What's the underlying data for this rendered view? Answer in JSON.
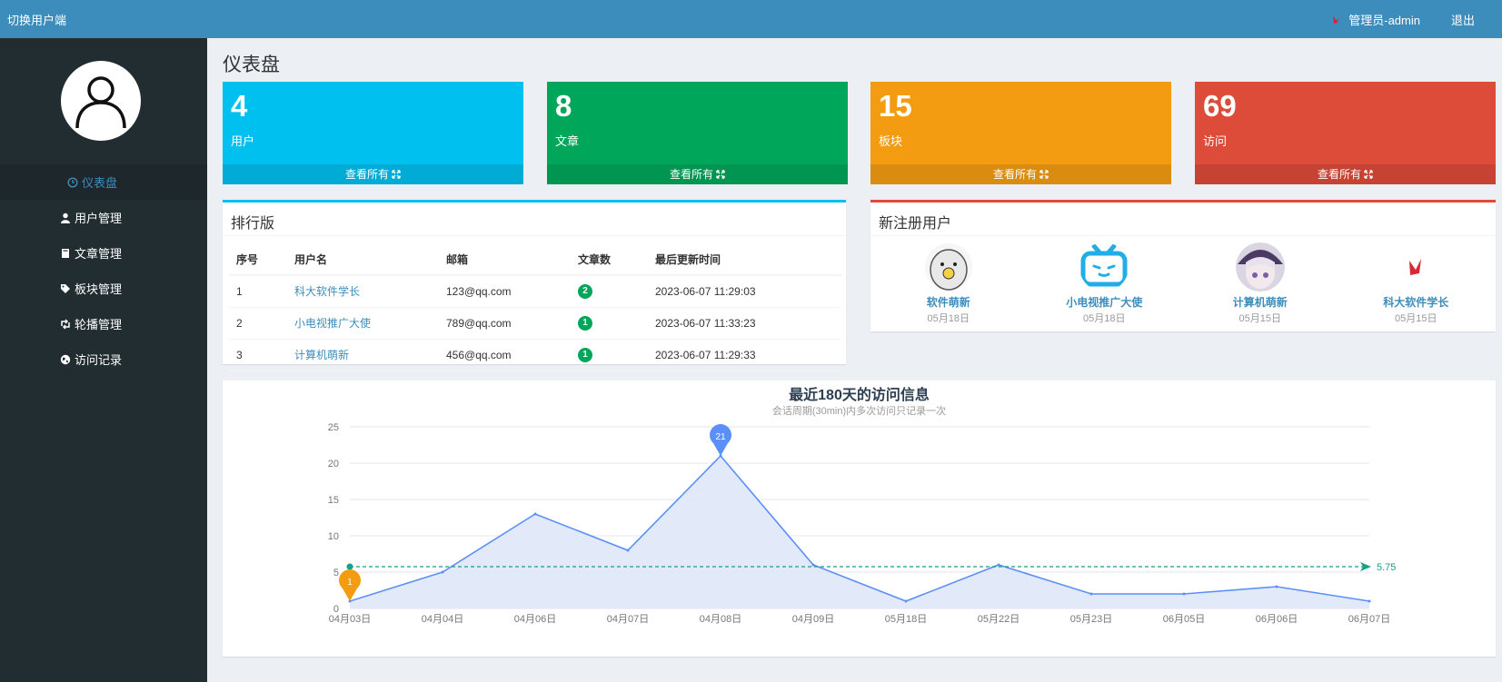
{
  "topbar": {
    "brand": "切换用户端",
    "admin": "管理员-admin",
    "logout": "退出"
  },
  "sidebar": {
    "items": [
      {
        "label": "仪表盘",
        "icon": "dashboard-icon"
      },
      {
        "label": "用户管理",
        "icon": "user-icon"
      },
      {
        "label": "文章管理",
        "icon": "book-icon"
      },
      {
        "label": "板块管理",
        "icon": "tag-icon"
      },
      {
        "label": "轮播管理",
        "icon": "retweet-icon"
      },
      {
        "label": "访问记录",
        "icon": "globe-icon"
      }
    ]
  },
  "page": {
    "title": "仪表盘"
  },
  "stats": [
    {
      "value": "4",
      "label": "用户",
      "link": "查看所有",
      "color": "#00c0ef"
    },
    {
      "value": "8",
      "label": "文章",
      "link": "查看所有",
      "color": "#00a65a"
    },
    {
      "value": "15",
      "label": "板块",
      "link": "查看所有",
      "color": "#f39c12"
    },
    {
      "value": "69",
      "label": "访问",
      "link": "查看所有",
      "color": "#dd4b39"
    }
  ],
  "ranking": {
    "title": "排行版",
    "headers": [
      "序号",
      "用户名",
      "邮箱",
      "文章数",
      "最后更新时间"
    ],
    "rows": [
      {
        "no": "1",
        "name": "科大软件学长",
        "email": "123@qq.com",
        "count": "2",
        "time": "2023-06-07 11:29:03"
      },
      {
        "no": "2",
        "name": "小电视推广大使",
        "email": "789@qq.com",
        "count": "1",
        "time": "2023-06-07 11:33:23"
      },
      {
        "no": "3",
        "name": "计算机萌新",
        "email": "456@qq.com",
        "count": "1",
        "time": "2023-06-07 11:29:33"
      }
    ]
  },
  "new_users": {
    "title": "新注册用户",
    "users": [
      {
        "name": "软件萌新",
        "date": "05月18日"
      },
      {
        "name": "小电视推广大使",
        "date": "05月18日"
      },
      {
        "name": "计算机萌新",
        "date": "05月15日"
      },
      {
        "name": "科大软件学长",
        "date": "05月15日"
      }
    ]
  },
  "chart": {
    "title": "最近180天的访问信息",
    "subtitle": "会话周期(30min)内多次访问只记录一次"
  },
  "chart_data": {
    "type": "area",
    "title": "最近180天的访问信息",
    "subtitle": "会话周期(30min)内多次访问只记录一次",
    "x": [
      "04月03日",
      "04月04日",
      "04月06日",
      "04月07日",
      "04月08日",
      "04月09日",
      "05月18日",
      "05月22日",
      "05月23日",
      "06月05日",
      "06月06日",
      "06月07日"
    ],
    "values": [
      1,
      5,
      13,
      8,
      21,
      6,
      1,
      6,
      2,
      2,
      3,
      1
    ],
    "ylim": [
      0,
      25
    ],
    "yticks": [
      0,
      5,
      10,
      15,
      20,
      25
    ],
    "max_marker": {
      "label": "21",
      "value": 21
    },
    "min_marker": {
      "label": "1",
      "value": 1
    },
    "average_line": {
      "value": 5.75,
      "label": "5.75"
    },
    "colors": {
      "line": "#5b8ff9",
      "area": "#dfe8f9",
      "max": "#5b8ff9",
      "min": "#f39c12",
      "average": "#16a085"
    },
    "grid": true
  }
}
